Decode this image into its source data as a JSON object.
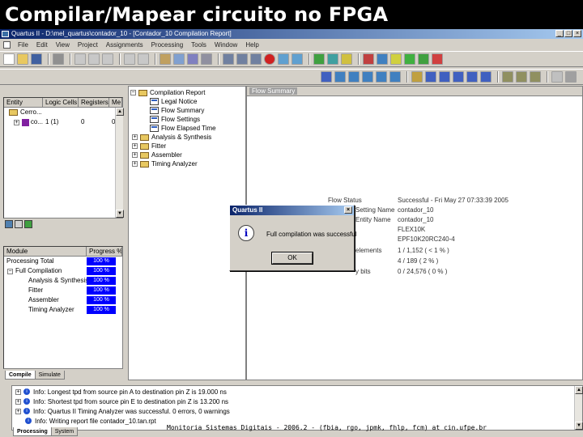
{
  "slide": {
    "title": "Compilar/Mapear circuito no FPGA",
    "footer": "Monitoria Sistemas Digitais - 2006.2 - (fbia, rgo, jpmk, fhlp, fcm) at cin.ufpe.br"
  },
  "window": {
    "title": "Quartus II - D:\\mel_quartus\\contador_10 - [Contador_10 Compilation Report]",
    "minimize": "_",
    "maximize": "□",
    "close": "×"
  },
  "menu": [
    "File",
    "Edit",
    "View",
    "Project",
    "Assignments",
    "Processing",
    "Tools",
    "Window",
    "Help"
  ],
  "hierarchy": {
    "headers": [
      "Entity",
      "Logic Cells",
      "Registers",
      "Me"
    ],
    "rows": [
      {
        "entity": "Cerro...",
        "lc": "",
        "reg": "",
        "me": ""
      },
      {
        "entity": "co...",
        "lc": "1 (1)",
        "reg": "0",
        "me": "0"
      }
    ]
  },
  "status": {
    "headers": [
      "Module",
      "Progress %"
    ],
    "rows": [
      {
        "module": "Processing Total",
        "progress": "100 %"
      },
      {
        "module": "Full Compilation",
        "progress": "100 %"
      },
      {
        "module": "Analysis & Synthesis",
        "progress": "100 %"
      },
      {
        "module": "Fitter",
        "progress": "100 %"
      },
      {
        "module": "Assembler",
        "progress": "100 %"
      },
      {
        "module": "Timing Analyzer",
        "progress": "100 %"
      }
    ],
    "tabs": [
      "Compile",
      "Simulate"
    ]
  },
  "report_tree": [
    "Compilation Report",
    "Legal Notice",
    "Flow Summary",
    "Flow Settings",
    "Flow Elapsed Time",
    "Analysis & Synthesis",
    "Fitter",
    "Assembler",
    "Timing Analyzer"
  ],
  "flow_summary": {
    "title": "Flow Summary",
    "rows": [
      {
        "label": "Flow Status",
        "value": "Successful - Fri May 27 07:33:39 2005"
      },
      {
        "label": "Setting Name",
        "value": "contador_10"
      },
      {
        "label": "Entity Name",
        "value": "contador_10"
      },
      {
        "label": "",
        "value": "FLEX10K"
      },
      {
        "label": "",
        "value": "EPF10K20RC240-4"
      },
      {
        "label": "elements",
        "value": "1 / 1,152 ( < 1 % )"
      },
      {
        "label": "",
        "value": "4 / 189 ( 2 % )"
      },
      {
        "label": "y bits",
        "value": "0 / 24,576 ( 0 % )"
      }
    ]
  },
  "dialog": {
    "title": "Quartus II",
    "message": "Full compilation was successful",
    "ok": "OK",
    "icon": "i",
    "close": "×"
  },
  "messages": {
    "lines": [
      "Info: Longest tpd from source pin A to destination pin Z is 19.000 ns",
      "Info: Shortest tpd from source pin E to destination pin Z is 13.200 ns",
      "Info: Quartus II Timing Analyzer was successful. 0 errors, 0 warnings",
      "Info: Writing report file contador_10.tan.rpt"
    ],
    "tabs": [
      "Processing",
      "System"
    ]
  }
}
